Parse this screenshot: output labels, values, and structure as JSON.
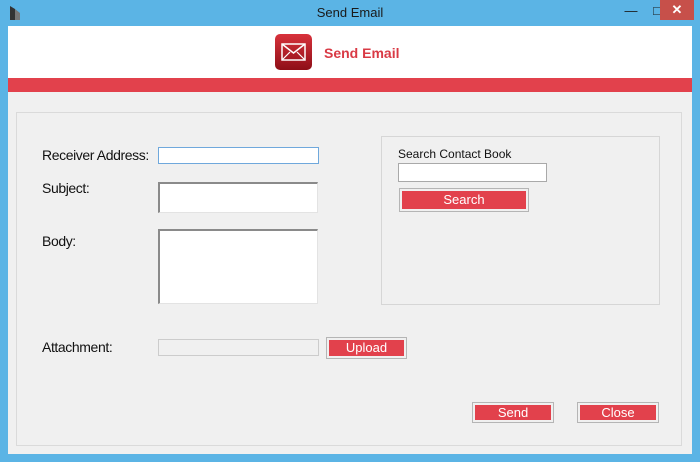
{
  "window": {
    "title": "Send Email",
    "min_icon": "minimize-icon",
    "max_icon": "maximize-icon",
    "close_icon": "close-icon",
    "min_glyph": "—",
    "max_glyph": "□",
    "close_glyph": "✕"
  },
  "header": {
    "title": "Send Email",
    "logo_icon": "envelope-icon"
  },
  "colors": {
    "accent": "#e2414c",
    "titlebar": "#5bb4e5",
    "close_button": "#c7504a"
  },
  "form": {
    "receiver_label": "Receiver Address:",
    "receiver_value": "",
    "subject_label": "Subject:",
    "subject_value": "",
    "body_label": "Body:",
    "body_value": "",
    "attachment_label": "Attachment:",
    "attachment_value": "",
    "upload_label": "Upload"
  },
  "contact_book": {
    "label": "Search Contact Book",
    "search_value": "",
    "search_button": "Search"
  },
  "actions": {
    "send_label": "Send",
    "close_label": "Close"
  }
}
